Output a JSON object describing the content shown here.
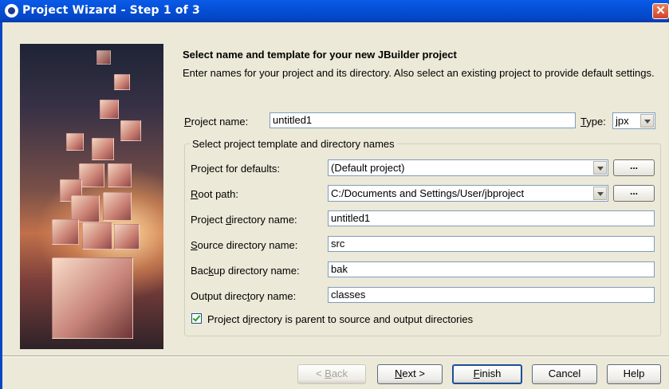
{
  "window": {
    "title": "Project Wizard - Step 1 of 3"
  },
  "header": {
    "heading": "Select name and template for your new JBuilder project",
    "description": "Enter names for your project and its directory. Also select an existing project to provide default settings."
  },
  "project_name": {
    "label_pre": "P",
    "label_rest": "roject name:",
    "value": "untitled1"
  },
  "type": {
    "label_pre": "T",
    "label_rest": "ype:",
    "value": "jpx"
  },
  "group": {
    "title": "Select project template and directory names"
  },
  "defaults": {
    "label_pre": "Pro",
    "label_u": "j",
    "label_post": "ect for defaults:",
    "value": "(Default project)",
    "browse": "..."
  },
  "root_path": {
    "label_pre": "",
    "label_u": "R",
    "label_post": "oot path:",
    "value": "C:/Documents and Settings/User/jbproject",
    "browse": "..."
  },
  "project_dir": {
    "label_pre": "Project ",
    "label_u": "d",
    "label_post": "irectory name:",
    "value": "untitled1"
  },
  "source_dir": {
    "label_pre": "",
    "label_u": "S",
    "label_post": "ource directory name:",
    "value": "src"
  },
  "backup_dir": {
    "label_pre": "Bac",
    "label_u": "k",
    "label_post": "up directory name:",
    "value": "bak"
  },
  "output_dir": {
    "label_pre": "Output direc",
    "label_u": "t",
    "label_post": "ory name:",
    "value": "classes"
  },
  "checkbox": {
    "checked": true,
    "label_pre": "Project d",
    "label_u": "i",
    "label_post": "rectory is parent to source and output directories"
  },
  "buttons": {
    "back": {
      "pre": "< ",
      "u": "B",
      "post": "ack",
      "enabled": false
    },
    "next": {
      "pre": "",
      "u": "N",
      "post": "ext >"
    },
    "finish": {
      "pre": "",
      "u": "F",
      "post": "inish"
    },
    "cancel": {
      "label": "Cancel"
    },
    "help": {
      "label": "Help"
    }
  },
  "colors": {
    "titlebar": "#0550D8",
    "dialog_bg": "#ECE9D8",
    "field_border": "#7F9DB9",
    "close_button": "#D4402A"
  }
}
